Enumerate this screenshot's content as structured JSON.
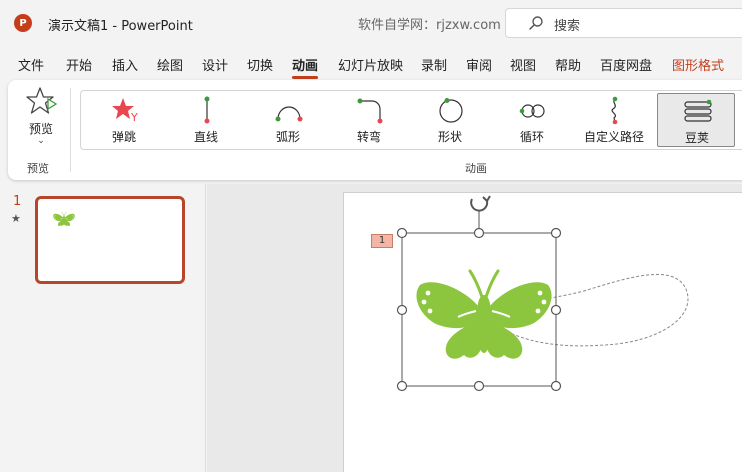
{
  "titlebar": {
    "app_logo": "P",
    "doc_title": "演示文稿1  -  PowerPoint",
    "watermark": "软件自学网：rjzxw.com",
    "search_placeholder": "搜索",
    "search_icon": "search-icon"
  },
  "menu": {
    "items": [
      "文件",
      "开始",
      "插入",
      "绘图",
      "设计",
      "切换",
      "动画",
      "幻灯片放映",
      "录制",
      "审阅",
      "视图",
      "帮助",
      "百度网盘",
      "图形格式"
    ],
    "active_index": 6,
    "contextual_index": 13,
    "accent": "#c43e1c"
  },
  "ribbon": {
    "preview_label": "预览",
    "preview_group_label": "预览",
    "animation_group_label": "动画",
    "animations": [
      {
        "label": "弹跳",
        "icon": "bounce-star-icon"
      },
      {
        "label": "直线",
        "icon": "line-path-icon"
      },
      {
        "label": "弧形",
        "icon": "arc-path-icon"
      },
      {
        "label": "转弯",
        "icon": "turn-path-icon"
      },
      {
        "label": "形状",
        "icon": "shape-path-icon"
      },
      {
        "label": "循环",
        "icon": "loop-path-icon"
      },
      {
        "label": "自定义路径",
        "icon": "custom-path-icon"
      },
      {
        "label": "豆荚",
        "icon": "bean-pod-icon"
      }
    ],
    "selected_index": 7
  },
  "thumbnails": {
    "slide_number": "1",
    "animation_marker": "★"
  },
  "slide": {
    "animation_tag": "1",
    "butterfly_color": "#8cc63f"
  }
}
